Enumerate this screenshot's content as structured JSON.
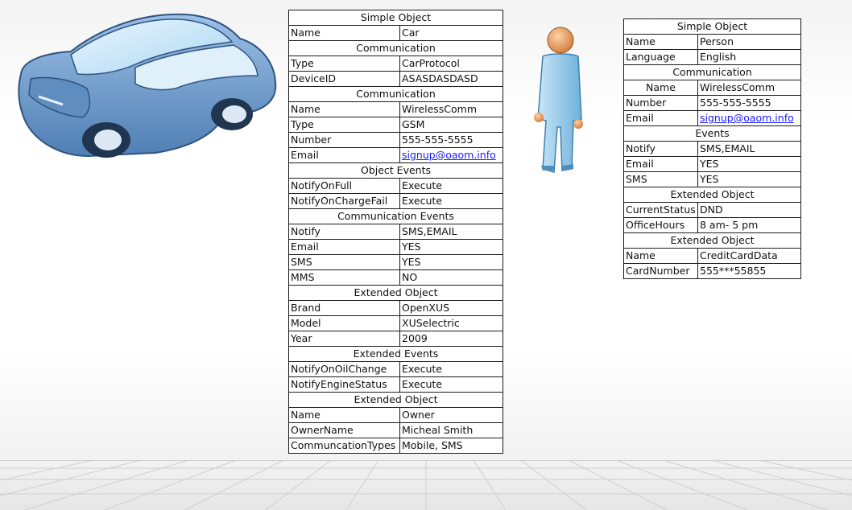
{
  "car_table": {
    "rows": [
      {
        "header": "Simple Object"
      },
      {
        "key": "Name",
        "value": "Car"
      },
      {
        "header": "Communication"
      },
      {
        "key": "Type",
        "value": "CarProtocol"
      },
      {
        "key": "DeviceID",
        "value": "ASASDASDASD"
      },
      {
        "header": "Communication"
      },
      {
        "key": "Name",
        "value": "WirelessComm"
      },
      {
        "key": "Type",
        "value": "GSM"
      },
      {
        "key": "Number",
        "value": "555-555-5555"
      },
      {
        "key": "Email",
        "value": "signup@oaom.info",
        "link": true
      },
      {
        "header": "Object Events"
      },
      {
        "key": "NotifyOnFull",
        "value": "Execute"
      },
      {
        "key": "NotifyOnChargeFail",
        "value": "Execute"
      },
      {
        "header": "Communication Events"
      },
      {
        "key": "Notify",
        "value": "SMS,EMAIL"
      },
      {
        "key": "Email",
        "value": "YES"
      },
      {
        "key": "SMS",
        "value": "YES"
      },
      {
        "key": "MMS",
        "value": "NO"
      },
      {
        "header": "Extended Object"
      },
      {
        "key": "Brand",
        "value": "OpenXUS"
      },
      {
        "key": "Model",
        "value": "XUSelectric"
      },
      {
        "key": "Year",
        "value": "2009"
      },
      {
        "header": "Extended Events"
      },
      {
        "key": "NotifyOnOilChange",
        "value": "Execute"
      },
      {
        "key": "NotifyEngineStatus",
        "value": "Execute"
      },
      {
        "header": "Extended Object"
      },
      {
        "key": "Name",
        "value": "Owner"
      },
      {
        "key": "OwnerName",
        "value": "Micheal Smith"
      },
      {
        "key": "CommuncationTypes",
        "value": "Mobile, SMS"
      }
    ]
  },
  "person_table": {
    "rows": [
      {
        "header": "Simple Object"
      },
      {
        "key": "Name",
        "value": "Person"
      },
      {
        "key": "Language",
        "value": "English"
      },
      {
        "header": "Communication"
      },
      {
        "key": "Name",
        "value": "WirelessComm",
        "center": true
      },
      {
        "key": "Number",
        "value": "555-555-5555"
      },
      {
        "key": "Email",
        "value": "signup@oaom.info",
        "link": true
      },
      {
        "header": "Events"
      },
      {
        "key": "Notify",
        "value": "SMS,EMAIL"
      },
      {
        "key": "Email",
        "value": "YES"
      },
      {
        "key": "SMS",
        "value": "YES"
      },
      {
        "header": "Extended Object"
      },
      {
        "key": "CurrentStatus",
        "value": "DND"
      },
      {
        "key": "OfficeHours",
        "value": "8 am- 5 pm"
      },
      {
        "header": "Extended Object"
      },
      {
        "key": "Name",
        "value": "CreditCardData"
      },
      {
        "key": "CardNumber",
        "value": "555***55855"
      }
    ]
  },
  "icons": [
    "car-icon",
    "person-icon"
  ],
  "colors": {
    "link": "#1a1aff",
    "car_body": "#6e9ccc",
    "person_body": "#8fc6e8",
    "person_head": "#e8a060"
  }
}
